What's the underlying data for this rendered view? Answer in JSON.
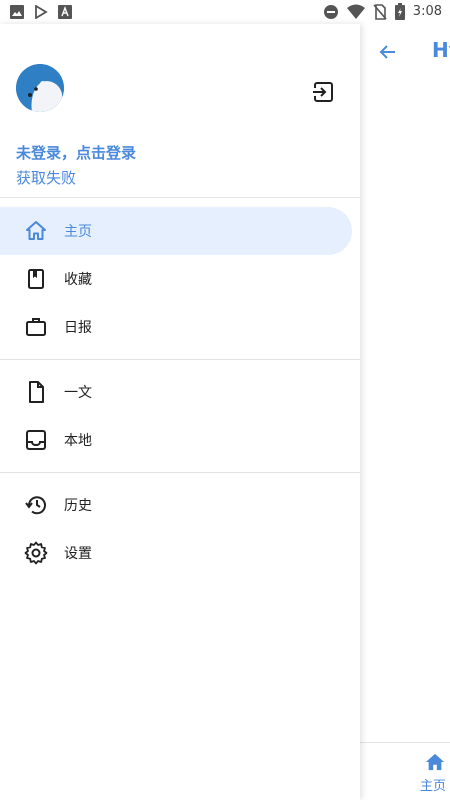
{
  "status_bar": {
    "time": "3:08",
    "left_icons": [
      "image-icon",
      "play-store-icon",
      "font-icon"
    ],
    "right_icons": [
      "do-not-disturb-icon",
      "wifi-icon",
      "no-sim-icon",
      "battery-icon"
    ]
  },
  "background_app": {
    "title": "Hy",
    "bottom_nav": {
      "home_label": "主页"
    }
  },
  "drawer": {
    "login_prompt": "未登录，点击登录",
    "status": "获取失败",
    "groups": [
      [
        {
          "label": "主页",
          "icon": "home-icon",
          "active": true
        },
        {
          "label": "收藏",
          "icon": "bookmark-book-icon"
        },
        {
          "label": "日报",
          "icon": "briefcase-icon"
        }
      ],
      [
        {
          "label": "一文",
          "icon": "document-icon"
        },
        {
          "label": "本地",
          "icon": "inbox-icon"
        }
      ],
      [
        {
          "label": "历史",
          "icon": "history-icon"
        },
        {
          "label": "设置",
          "icon": "gear-icon"
        }
      ]
    ]
  },
  "colors": {
    "accent": "#4a89dc",
    "active_bg": "#e5effd",
    "divider": "#e3e3e3",
    "icon": "#212121"
  }
}
